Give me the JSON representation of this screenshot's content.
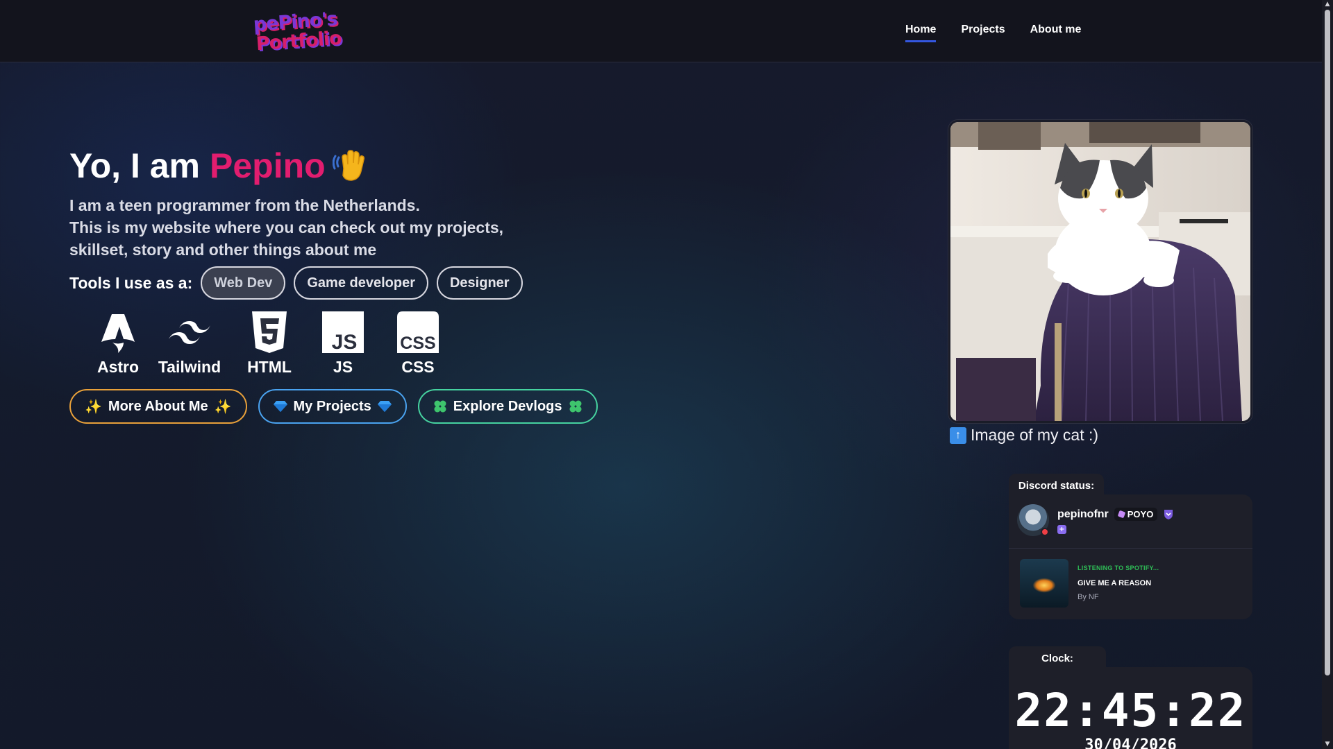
{
  "header": {
    "logo_line1": "pePino's",
    "logo_line2": "Portfolio",
    "nav": [
      {
        "label": "Home",
        "active": true
      },
      {
        "label": "Projects",
        "active": false
      },
      {
        "label": "About me",
        "active": false
      }
    ]
  },
  "hero": {
    "greeting": "Yo, I am",
    "name": "Pepino",
    "wave_icon": "waving-hand-icon",
    "desc_line1": "I am a teen programmer from the Netherlands.",
    "desc_line2": "This is my website where you can check out my projects,",
    "desc_line3": "skillset, story and other things about me"
  },
  "tools": {
    "label": "Tools I use as a:",
    "tabs": [
      {
        "label": "Web Dev",
        "active": true
      },
      {
        "label": "Game developer",
        "active": false
      },
      {
        "label": "Designer",
        "active": false
      }
    ],
    "items": [
      {
        "label": "Astro",
        "icon": "astro-icon"
      },
      {
        "label": "Tailwind",
        "icon": "tailwind-icon"
      },
      {
        "label": "HTML",
        "icon": "html5-icon"
      },
      {
        "label": "JS",
        "icon": "js-icon"
      },
      {
        "label": "CSS",
        "icon": "css-icon"
      }
    ]
  },
  "buttons": {
    "more_about": "More About Me",
    "my_projects": "My Projects",
    "explore_devlogs": "Explore Devlogs"
  },
  "cat": {
    "caption": "Image of my cat :)",
    "caption_icon": "up-arrow-icon"
  },
  "discord": {
    "title": "Discord status:",
    "username": "pepinofnr",
    "tag": "POYO",
    "status": "dnd",
    "activity_type": "LISTENING TO SPOTIFY...",
    "song": "GIVE ME A REASON",
    "artist": "By NF"
  },
  "clock": {
    "title": "Clock:",
    "time": "22:45:22",
    "date": "30/04/2026"
  },
  "colors": {
    "accent_pink": "#e21d6f",
    "nav_underline": "#3457e0",
    "btn_orange": "#e9a13a",
    "btn_blue": "#4aa3f0",
    "btn_green": "#46d3a0",
    "spotify_green": "#2fbf57"
  }
}
